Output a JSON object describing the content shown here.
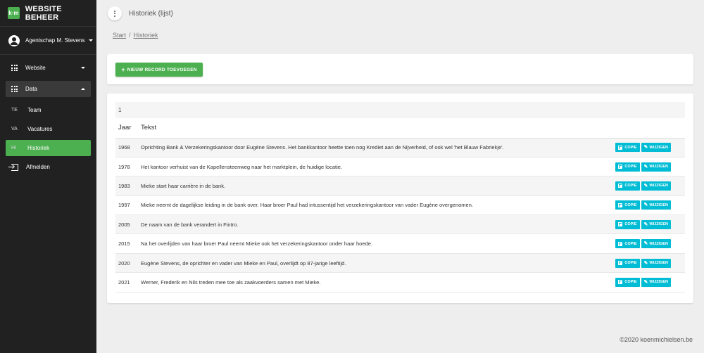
{
  "brand": {
    "logo": "k·m",
    "title": "WEBSITE BEHEER"
  },
  "user": {
    "name": "Agentschap M. Stevens"
  },
  "sidebar": {
    "groups": [
      {
        "label": "Website"
      },
      {
        "label": "Data"
      }
    ],
    "items": [
      {
        "abbr": "TE",
        "label": "Team"
      },
      {
        "abbr": "VA",
        "label": "Vacatures"
      },
      {
        "abbr": "HI",
        "label": "Historiek"
      }
    ],
    "logout": "Afmelden"
  },
  "header": {
    "title": "Historiek (lijst)"
  },
  "breadcrumb": {
    "home": "Start",
    "separator": "/",
    "current": "Historiek"
  },
  "actions": {
    "add_label": "NIEUW RECORD TOEVOEGEN"
  },
  "table": {
    "pager": "1",
    "columns": [
      "Jaar",
      "Tekst"
    ],
    "copy_label": "COPIE",
    "edit_label": "WIJZIGEN",
    "rows": [
      {
        "year": "1968",
        "text": "Oprichting Bank & Verzekeringskantoor door Eugène Stevens. Het bankkantoor heette toen nog Krediet aan de Nijverheid, of ook wel 'het Blauw Fabriekje'."
      },
      {
        "year": "1978",
        "text": "Het kantoor verhuist van de Kapellensteenweg naar het marktplein, de huidige locatie."
      },
      {
        "year": "1983",
        "text": "Mieke start haar carrière in de bank."
      },
      {
        "year": "1997",
        "text": "Mieke neemt de dagelijkse leiding in de bank over. Haar broer Paul had intussentijd het verzekeringskantoor van vader Eugène overgenomen."
      },
      {
        "year": "2005",
        "text": "De naam van de bank verandert in Fintro."
      },
      {
        "year": "2015",
        "text": "Na het overlijden van haar broer Paul neemt Mieke ook het verzekeringskantoor onder haar hoede."
      },
      {
        "year": "2020",
        "text": "Eugène Stevens, de oprichter en vader van Mieke en Paul, overlijdt op 87-jarige leeftijd."
      },
      {
        "year": "2021",
        "text": "Werner, Frederik en Nils treden mee toe als zaakvoerders samen met Mieke."
      }
    ]
  },
  "footer": {
    "text": "©2020 koenmichielsen.be"
  },
  "colors": {
    "sidebar": "#212121",
    "accent_green": "#4caf50",
    "button_cyan": "#00bcd4",
    "background": "#eeeeee"
  },
  "icons": {
    "menu": "more-vert-icon",
    "user": "account-circle-icon",
    "group": "apps-icon",
    "logout": "exit-icon",
    "copy": "copy-icon",
    "edit": "pencil-icon"
  }
}
